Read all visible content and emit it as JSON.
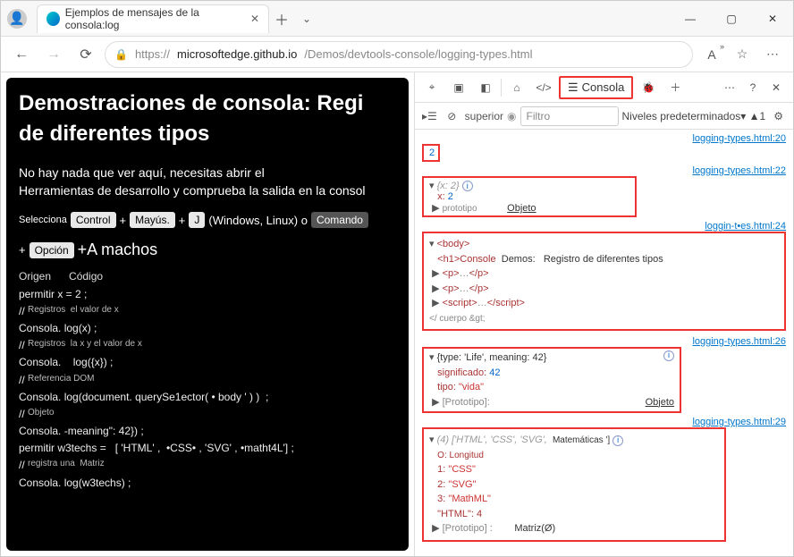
{
  "titlebar": {
    "tab_title": "Ejemplos de mensajes de la consola:log"
  },
  "addrbar": {
    "protocol": "https://",
    "host": "microsoftedge.github.io",
    "path": "/Demos/devtools-console/logging-types.html"
  },
  "page": {
    "h1_line1": "Demostraciones de consola: Regi",
    "h1_line2": "de diferentes tipos",
    "intro_line1": "No hay nada que ver aquí, necesitas abrir el",
    "intro_line2": "Herramientas de desarrollo y comprueba la salida en la consol",
    "kbd_sel": "Selecciona",
    "kbd_control": "Control",
    "kbd_plus": "+",
    "kbd_shift": "Mayús.",
    "kbd_J": "J",
    "kbd_winlinux": "(Windows, Linux) o",
    "kbd_command": "Comando",
    "kbd_option": "Opción",
    "kbd_A": "+A machos",
    "code_header_source": "Origen",
    "code_header_code": "Código",
    "code_lines": [
      "permitir x = 2 ;",
      "//",
      "Consola. log(x) ;",
      "//",
      "Consola.    log({x}) ;",
      "//  Registros",
      "Consola. log(document. querySe1ector( • body ' ) )  ;",
      "//  Registros",
      "Consola. -meaning\": 42}) ;",
      "permitir w3techs =   [ 'HTML' ,  •CSS• , 'SVG' , •matht4L'] ;",
      "//",
      "Consola. log(w3techs) ;"
    ],
    "code_comments": [
      "",
      "Registros  el valor de x",
      "",
      "Registros  la x y el valor de x",
      "",
      "Referencia DOM",
      "",
      "Objeto",
      "",
      "",
      "registra una  Matriz",
      ""
    ]
  },
  "devtools": {
    "tab_console": "Consola",
    "context": "superior",
    "filter_placeholder": "Filtro",
    "levels": "Niveles predeterminados",
    "issues": "1",
    "link20": "logging-types.html:20",
    "link22": "logging-types.html:22",
    "link24": "loggin-t•es.html:24",
    "link26": "logging-types.html:26",
    "link29": "logging-types.html:29",
    "row1": {
      "val": "2"
    },
    "row2": {
      "head": "{x: 2}",
      "x_label": "x:",
      "x_val": "2",
      "proto_label": "prototipo",
      "proto_val": "Objeto"
    },
    "row3": {
      "body_open": "<body>",
      "h1": "<h1>Console",
      "h1_txt1": "Demos:",
      "h1_txt2": "Registro de diferentes tipos",
      "p": "<p>",
      "dots": "…",
      "p_close": "</p>",
      "script": "<script>",
      "script_dots": "…",
      "script_close": "</script>",
      "end": "</ cuerpo &gt;"
    },
    "row4": {
      "head": "{type: 'Life', meaning: 42}",
      "meaning_lbl": "significado:",
      "meaning_val": "42",
      "type_lbl": "tipo:",
      "type_val": "\"vida\"",
      "proto_lbl": "[Prototipo]:",
      "proto_val": "Objeto"
    },
    "row5": {
      "head": "(4) ['HTML', 'CSS', 'SVG',",
      "head2": "Matemáticas ']",
      "idx0": "O: Longitud",
      "idx1": "1:",
      "v1": "\"CSS\"",
      "idx2": "2:",
      "v2": "\"SVG\"",
      "idx3": "3:",
      "v3": "\"MathML\"",
      "len": "\"HTML\": 4",
      "proto_lbl": "[Prototipo] :",
      "proto_val": "Matriz(Ø)"
    }
  }
}
